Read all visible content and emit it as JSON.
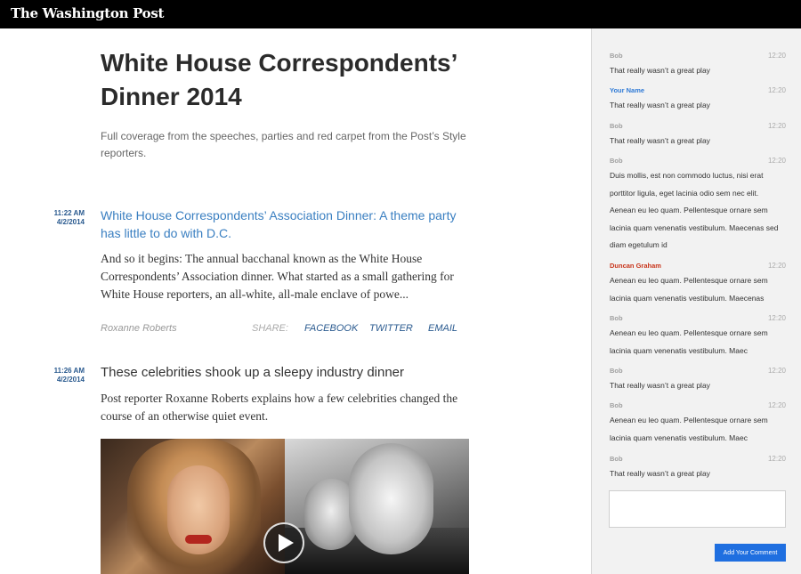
{
  "header": {
    "brand": "The Washington Post"
  },
  "article": {
    "title": "White House Correspondents’ Dinner 2014",
    "subtitle": "Full coverage from the speeches, parties and red carpet from the Post’s Style reporters."
  },
  "posts": [
    {
      "time": "11:22 AM",
      "date": "4/2/2014",
      "headline": "White House Correspondents’ Association Dinner: A theme party has little to do with D.C.",
      "body": "And so it begins: The annual bacchanal known as the White House Correspondents’ Association dinner. What started as a small gathering for White House reporters, an all-white, all-male enclave of powe...",
      "author": "Roxanne Roberts",
      "share_label": "SHARE:",
      "share_links": [
        "FACEBOOK",
        "TWITTER",
        "EMAIL"
      ]
    },
    {
      "time": "11:26 AM",
      "date": "4/2/2014",
      "headline": "These celebrities shook up a sleepy industry dinner",
      "body": "Post reporter Roxanne Roberts explains how a few celebrities changed the course of an otherwise quiet event."
    }
  ],
  "comments": [
    {
      "author": "Bob",
      "time": "12:20",
      "text": "That really wasn’t a great play"
    },
    {
      "author": "Your Name",
      "time": "12:20",
      "text": "That really wasn’t a great play"
    },
    {
      "author": "Bob",
      "time": "12:20",
      "text": "That really wasn’t a great play"
    },
    {
      "author": "Bob",
      "time": "12:20",
      "text": "Duis mollis, est non commodo luctus, nisi erat porttitor ligula, eget lacinia odio sem nec elit. Aenean eu leo quam. Pellentesque ornare sem lacinia quam venenatis vestibulum. Maecenas sed diam egetulum id"
    },
    {
      "author": "Duncan Graham",
      "time": "12:20",
      "text": "Aenean eu leo quam. Pellentesque ornare sem lacinia quam venenatis vestibulum. Maecenas"
    },
    {
      "author": "Bob",
      "time": "12:20",
      "text": "Aenean eu leo quam. Pellentesque ornare sem lacinia quam venenatis vestibulum. Maec"
    },
    {
      "author": "Bob",
      "time": "12:20",
      "text": "That really wasn’t a great play"
    },
    {
      "author": "Bob",
      "time": "12:20",
      "text": "Aenean eu leo quam. Pellentesque ornare sem lacinia quam venenatis vestibulum. Maec"
    },
    {
      "author": "Bob",
      "time": "12:20",
      "text": "That really wasn’t a great play"
    }
  ],
  "comment_form": {
    "input_value": "",
    "submit_label": "Add Your Comment"
  },
  "colors": {
    "accent_link": "#3a7fc1",
    "current_user": "#2f7ad6",
    "highlight_author": "#c8341a",
    "button": "#1f6fe0",
    "topbar": "#000000"
  },
  "icons": {
    "play": "play-icon"
  }
}
